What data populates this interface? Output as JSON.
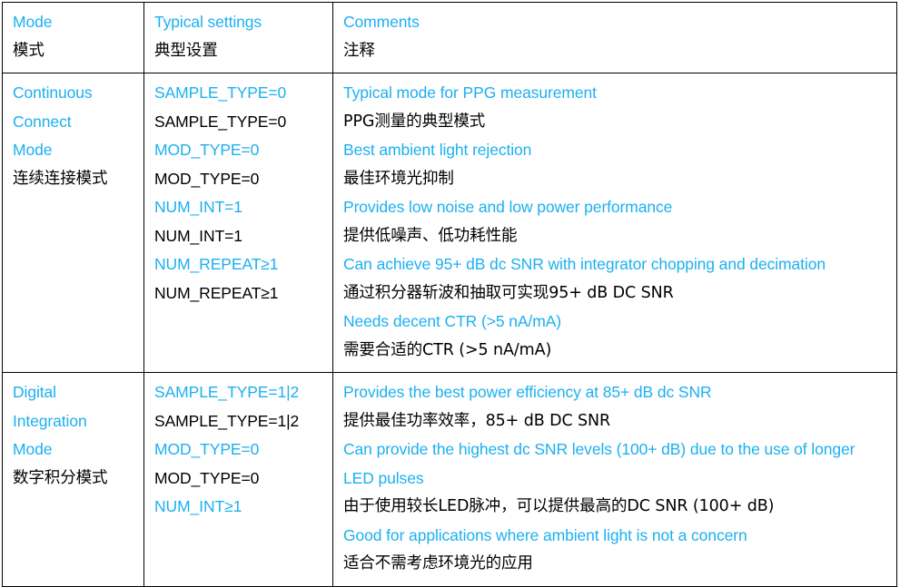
{
  "table": {
    "columns": [
      {
        "en": "Mode",
        "zh": "模式"
      },
      {
        "en": "Typical settings",
        "zh": "典型设置"
      },
      {
        "en": "Comments",
        "zh": "注释"
      }
    ],
    "accent_color": "#1CB0F0",
    "text_color": "#000000",
    "border_color": "#000000",
    "rows": [
      {
        "mode": {
          "en_lines": [
            "Continuous",
            "Connect",
            "Mode"
          ],
          "zh_lines": [
            "连续连接模式"
          ]
        },
        "settings": [
          {
            "lang": "en",
            "text": "SAMPLE_TYPE=0"
          },
          {
            "lang": "zh",
            "text": "SAMPLE_TYPE=0"
          },
          {
            "lang": "en",
            "text": "MOD_TYPE=0"
          },
          {
            "lang": "zh",
            "text": "MOD_TYPE=0"
          },
          {
            "lang": "en",
            "text": "NUM_INT=1"
          },
          {
            "lang": "zh",
            "text": "NUM_INT=1"
          },
          {
            "lang": "en",
            "text": "NUM_REPEAT≥1"
          },
          {
            "lang": "zh",
            "text": "NUM_REPEAT≥1"
          }
        ],
        "comments": [
          {
            "lang": "en",
            "text": "Typical mode for PPG measurement"
          },
          {
            "lang": "zh",
            "text": "PPG测量的典型模式"
          },
          {
            "lang": "en",
            "text": "Best ambient light rejection"
          },
          {
            "lang": "zh",
            "text": "最佳环境光抑制"
          },
          {
            "lang": "en",
            "text": "Provides low noise and low power performance"
          },
          {
            "lang": "zh",
            "text": "提供低噪声、低功耗性能"
          },
          {
            "lang": "en",
            "text": "Can achieve 95+ dB dc SNR with integrator chopping and decimation"
          },
          {
            "lang": "zh",
            "text": "通过积分器斩波和抽取可实现95+ dB DC SNR"
          },
          {
            "lang": "en",
            "text": "Needs decent CTR (>5 nA/mA)"
          },
          {
            "lang": "zh",
            "text": "需要合适的CTR (>5 nA/mA)"
          }
        ]
      },
      {
        "mode": {
          "en_lines": [
            "Digital",
            "Integration",
            "Mode"
          ],
          "zh_lines": [
            "数字积分模式"
          ]
        },
        "settings": [
          {
            "lang": "en",
            "text": "SAMPLE_TYPE=1|2"
          },
          {
            "lang": "zh",
            "text": "SAMPLE_TYPE=1|2"
          },
          {
            "lang": "en",
            "text": "MOD_TYPE=0"
          },
          {
            "lang": "zh",
            "text": "MOD_TYPE=0"
          },
          {
            "lang": "en",
            "text": "NUM_INT≥1"
          }
        ],
        "comments": [
          {
            "lang": "en",
            "text": "Provides the best power efficiency at 85+ dB dc SNR"
          },
          {
            "lang": "zh",
            "text": "提供最佳功率效率，85+ dB DC SNR"
          },
          {
            "lang": "en",
            "text": "Can provide the highest dc SNR levels (100+ dB) due to the use of longer LED pulses"
          },
          {
            "lang": "zh",
            "text": "由于使用较长LED脉冲，可以提供最高的DC SNR (100+ dB)"
          },
          {
            "lang": "en",
            "text": "Good for applications where ambient light is not a concern"
          },
          {
            "lang": "zh",
            "text": "适合不需考虑环境光的应用"
          }
        ]
      }
    ]
  }
}
